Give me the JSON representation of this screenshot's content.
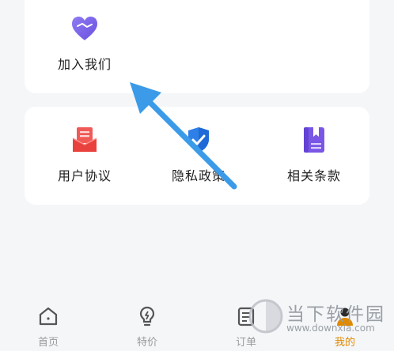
{
  "top_card": {
    "join_label": "加入我们"
  },
  "links": [
    {
      "label": "用户协议",
      "icon": "document-red-icon"
    },
    {
      "label": "隐私政策",
      "icon": "shield-check-icon"
    },
    {
      "label": "相关条款",
      "icon": "bookmark-book-icon"
    }
  ],
  "tabbar": {
    "items": [
      {
        "label": "首页",
        "icon": "home-icon",
        "active": false
      },
      {
        "label": "特价",
        "icon": "lightbulb-icon",
        "active": false
      },
      {
        "label": "订单",
        "icon": "order-list-icon",
        "active": false
      },
      {
        "label": "我的",
        "icon": "user-icon",
        "active": true
      }
    ]
  },
  "watermark": {
    "title": "当下软件园",
    "url": "www.downxia.com"
  },
  "colors": {
    "accent": "#e08a00",
    "arrow": "#3b9be8",
    "inactive": "#9a9a9a"
  }
}
